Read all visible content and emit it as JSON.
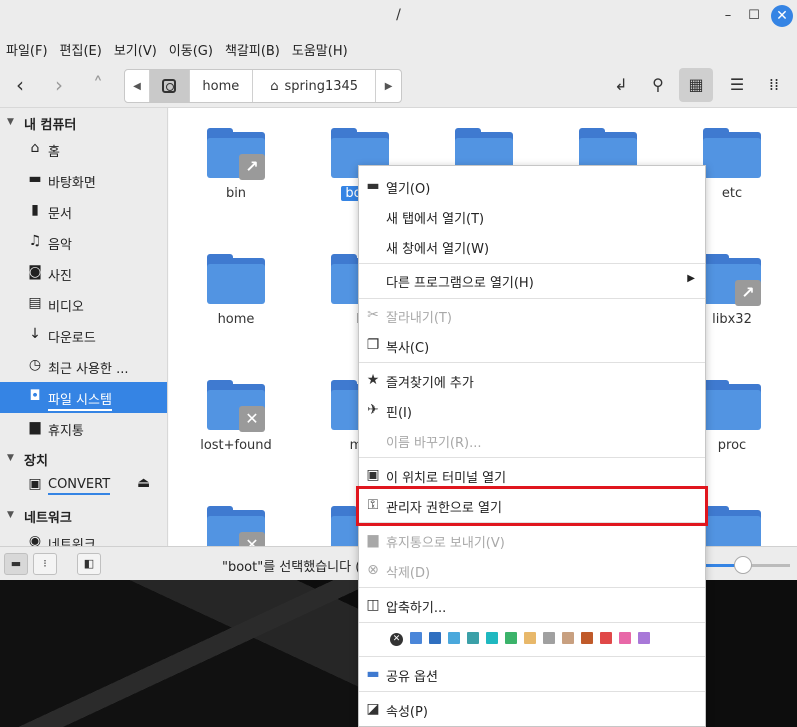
{
  "window": {
    "title": "/"
  },
  "menubar": [
    "파일(F)",
    "편집(E)",
    "보기(V)",
    "이동(G)",
    "책갈피(B)",
    "도움말(H)"
  ],
  "pathbar": {
    "home": "home",
    "user": "spring1345"
  },
  "sidebar": {
    "computer_header": "내 컴퓨터",
    "computer_items": [
      {
        "icon": "home-icon",
        "label": "홈"
      },
      {
        "icon": "desktop-icon",
        "label": "바탕화면"
      },
      {
        "icon": "document-icon",
        "label": "문서"
      },
      {
        "icon": "music-icon",
        "label": "음악"
      },
      {
        "icon": "camera-icon",
        "label": "사진"
      },
      {
        "icon": "video-icon",
        "label": "비디오"
      },
      {
        "icon": "download-icon",
        "label": "다운로드"
      },
      {
        "icon": "clock-icon",
        "label": "최근 사용한 ..."
      },
      {
        "icon": "drive-icon",
        "label": "파일 시스템"
      },
      {
        "icon": "trash-icon",
        "label": "휴지통"
      }
    ],
    "devices_header": "장치",
    "device_label": "CONVERT",
    "network_header": "네트워크",
    "network_label": "네트워크"
  },
  "files": [
    {
      "name": "bin",
      "badge": "link"
    },
    {
      "name": "boot",
      "badge": "",
      "selected": true
    },
    {
      "name": "",
      "badge": ""
    },
    {
      "name": "",
      "badge": ""
    },
    {
      "name": "etc",
      "badge": ""
    },
    {
      "name": "home",
      "badge": ""
    },
    {
      "name": "li",
      "badge": ""
    },
    {
      "name": "",
      "badge": ""
    },
    {
      "name": "",
      "badge": ""
    },
    {
      "name": "libx32",
      "badge": "link"
    },
    {
      "name": "lost+found",
      "badge": "locked"
    },
    {
      "name": "me",
      "badge": ""
    },
    {
      "name": "",
      "badge": ""
    },
    {
      "name": "",
      "badge": ""
    },
    {
      "name": "proc",
      "badge": ""
    }
  ],
  "statusbar": {
    "text": "\"boot\"를 선택했습니다 (",
    "zoom_level": 0.4
  },
  "context_menu": {
    "open": "열기(O)",
    "open_new_tab": "새 탭에서 열기(T)",
    "open_new_window": "새 창에서 열기(W)",
    "open_with": "다른 프로그램으로 열기(H)",
    "cut": "잘라내기(T)",
    "copy": "복사(C)",
    "add_bookmark": "즐겨찾기에 추가",
    "pin": "핀(I)",
    "rename": "이름 바꾸기(R)...",
    "open_terminal": "이 위치로 터미널 열기",
    "open_as_admin": "관리자 권한으로 열기",
    "move_to_trash": "휴지통으로 보내기(V)",
    "delete": "삭제(D)",
    "compress": "압축하기...",
    "share": "공유 옵션",
    "properties": "속성(P)",
    "colors": [
      "#4a86d9",
      "#2f6fc0",
      "#4aa8dc",
      "#3ba0a8",
      "#1fb8c0",
      "#3bb36a",
      "#e8b86a",
      "#a0a0a0",
      "#c8a080",
      "#c05a2a",
      "#e04848",
      "#e868a8",
      "#a878d8"
    ]
  }
}
